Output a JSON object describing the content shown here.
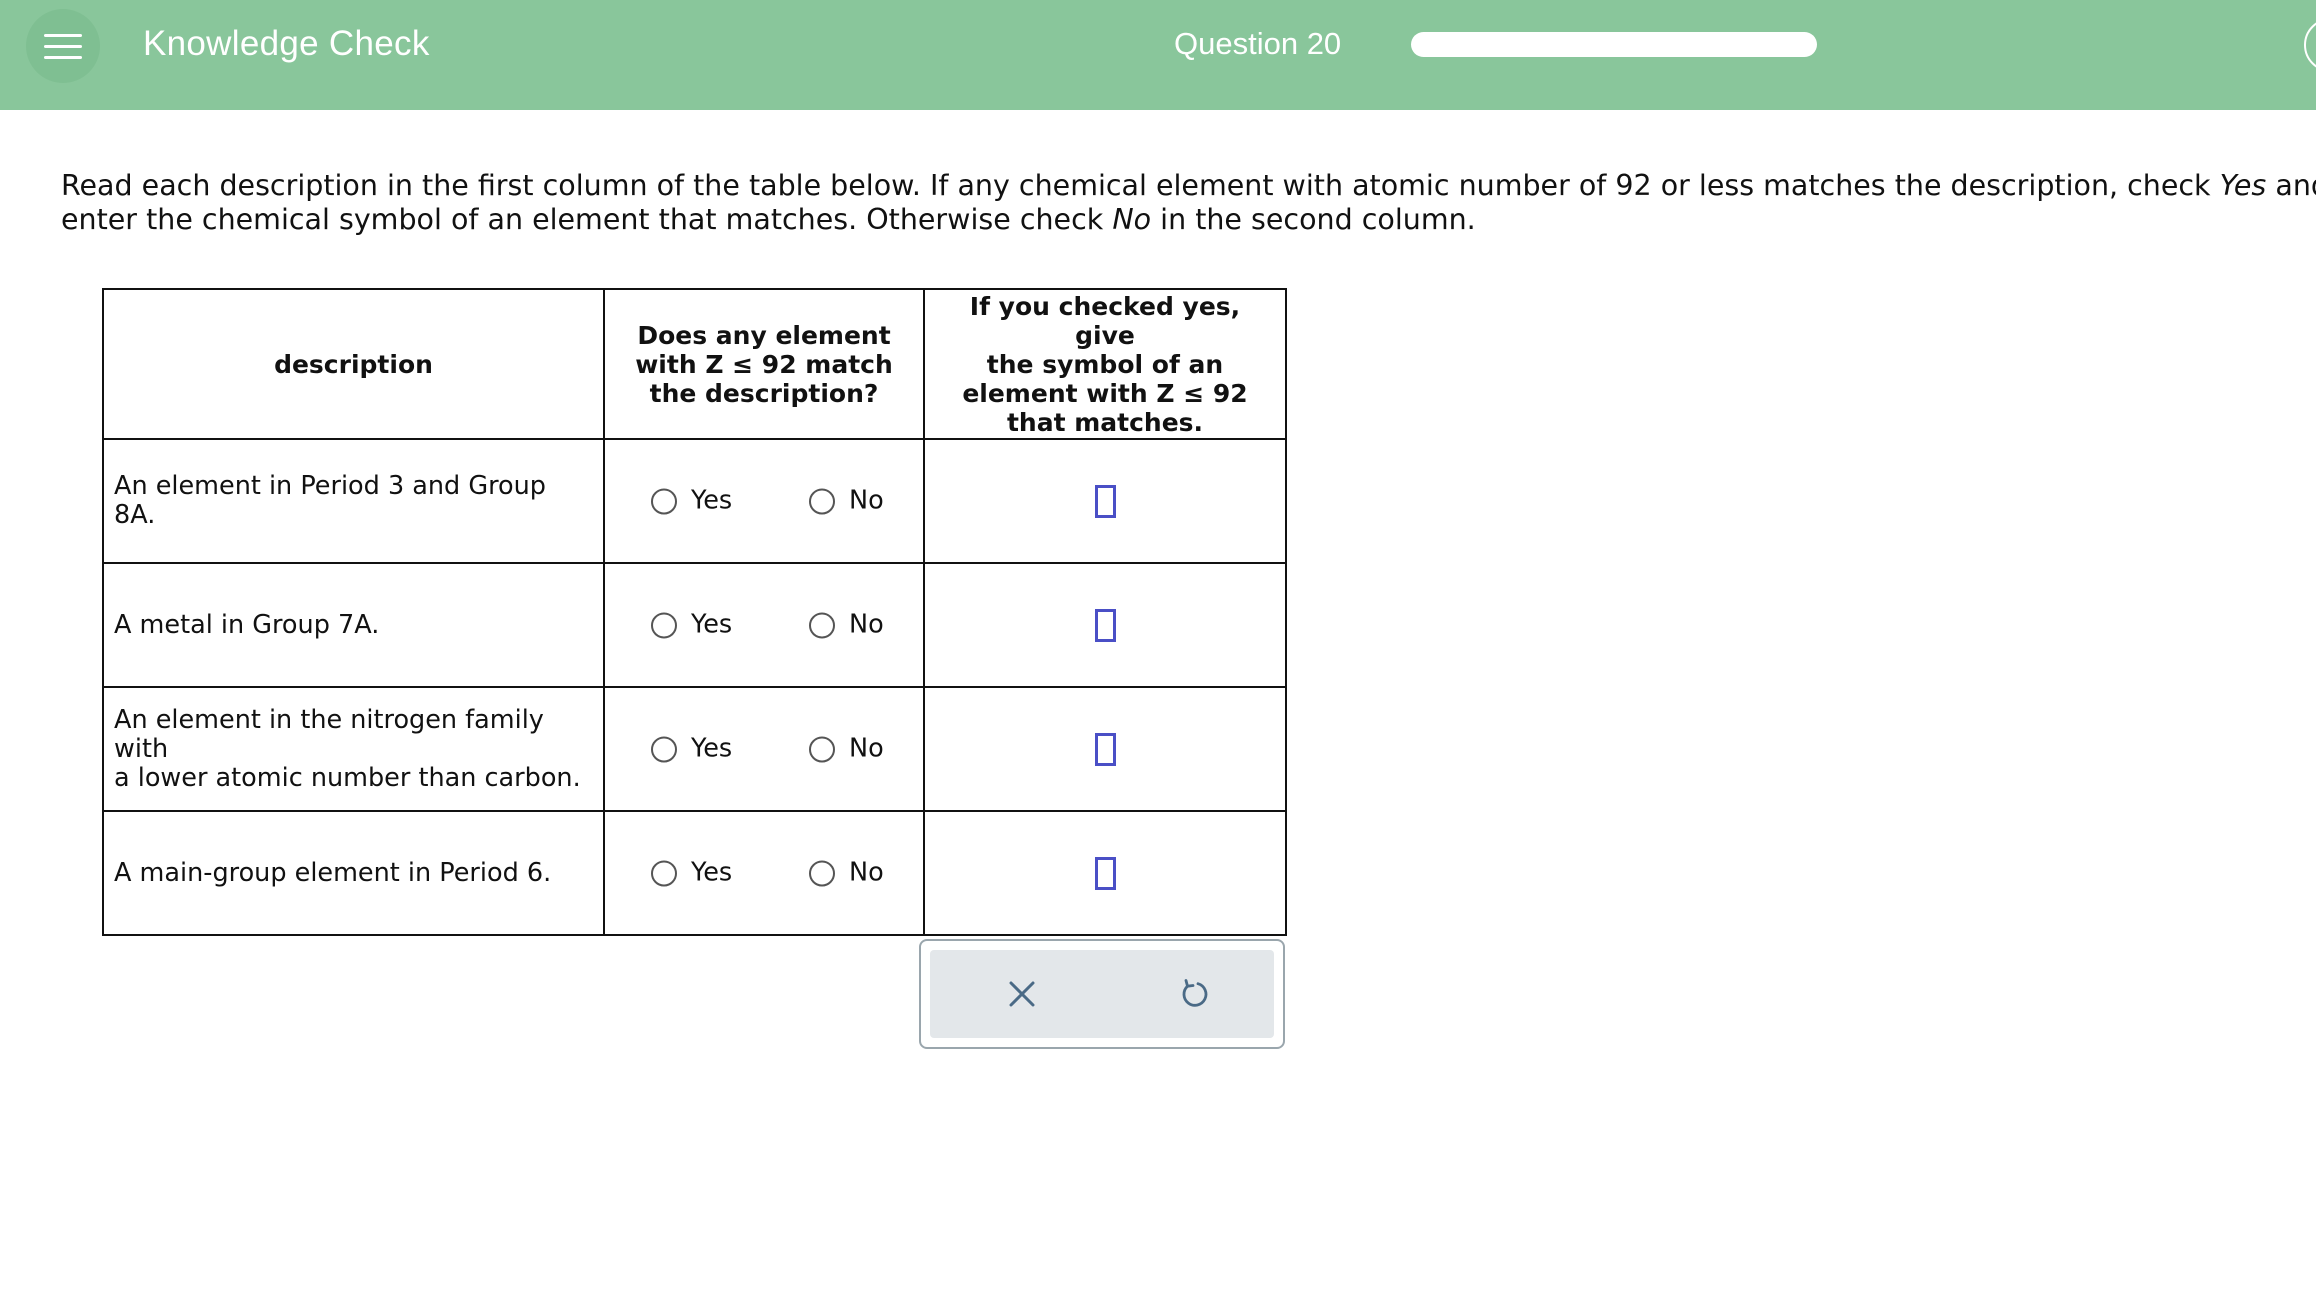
{
  "header": {
    "title": "Knowledge Check",
    "question_label": "Question 20",
    "progress_fraction": 1.0,
    "background_color": "#89c69b"
  },
  "instructions": {
    "line1_before_yes": "Read each description in the first column of the table below. If any chemical element with atomic number of 92 or less matches the description, check ",
    "line1_yes": "Yes",
    "line1_after_yes": " and",
    "line2_before_no": "enter the chemical symbol of an element that matches. Otherwise check ",
    "line2_no": "No",
    "line2_after_no": " in the second column."
  },
  "table": {
    "headers": {
      "description": "description",
      "match_line1": "Does any element",
      "match_line2": "with Z ≤ 92 match",
      "match_line3": "the description?",
      "symbol_line1": "If you checked yes, give",
      "symbol_line2": "the symbol of an",
      "symbol_line3": "element with Z ≤ 92",
      "symbol_line4": "that matches."
    },
    "rows": [
      {
        "line1": "An element in Period 3 and Group 8A.",
        "line2": "",
        "yes_label": "Yes",
        "no_label": "No",
        "answer": ""
      },
      {
        "line1": "A metal in Group 7A.",
        "line2": "",
        "yes_label": "Yes",
        "no_label": "No",
        "answer": ""
      },
      {
        "line1": "An element in the nitrogen family with",
        "line2": "a lower atomic number than carbon.",
        "yes_label": "Yes",
        "no_label": "No",
        "answer": ""
      },
      {
        "line1": "A main-group element in Period 6.",
        "line2": "",
        "yes_label": "Yes",
        "no_label": "No",
        "answer": ""
      }
    ]
  },
  "toolbar": {
    "clear_icon": "close-icon",
    "undo_icon": "undo-icon",
    "icon_color": "#4a6a86"
  }
}
